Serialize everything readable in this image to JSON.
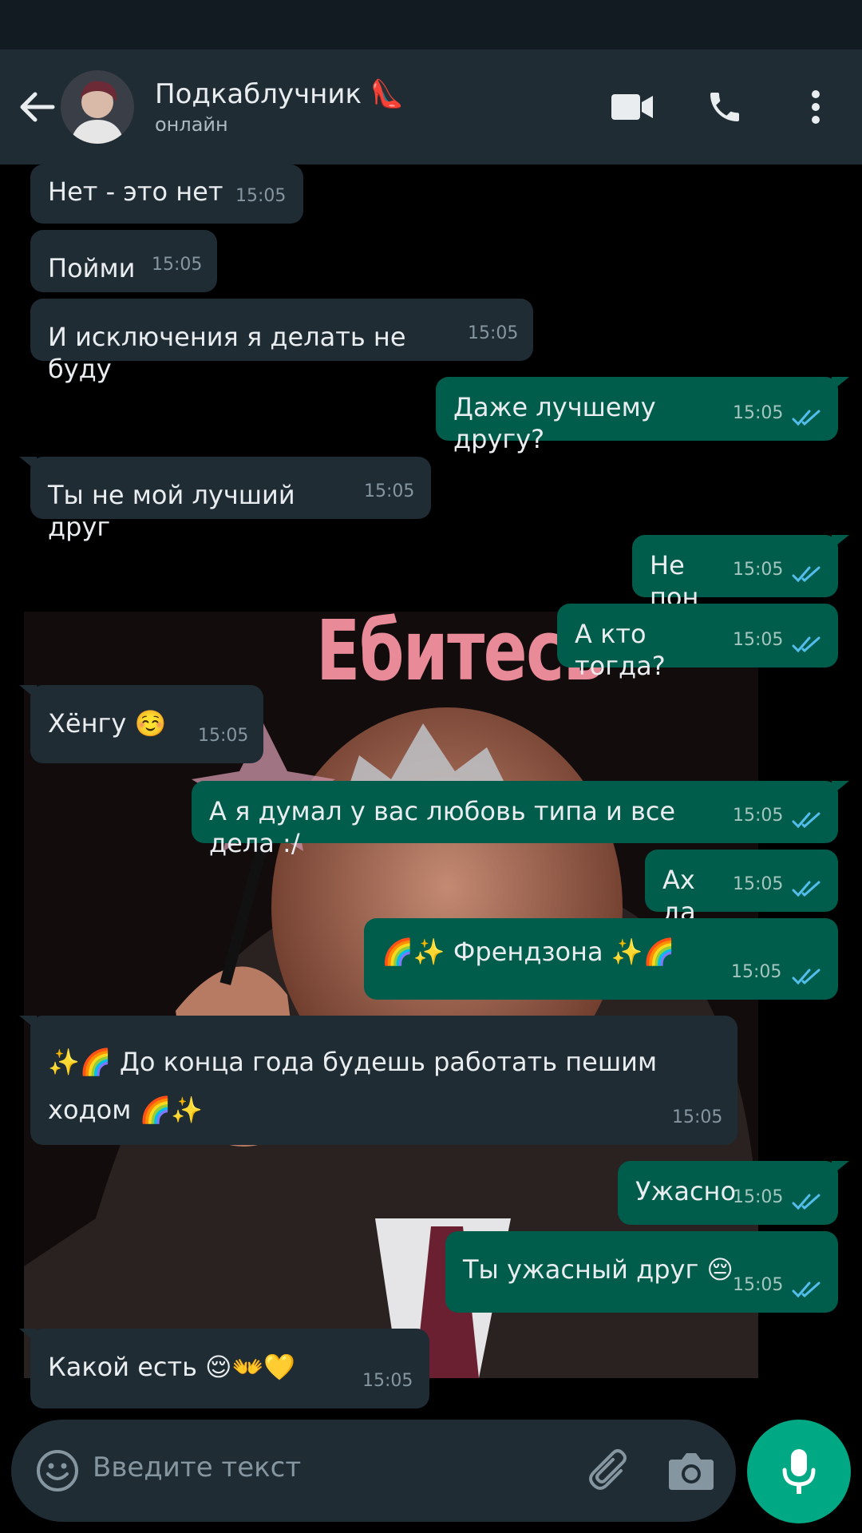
{
  "header": {
    "name": "Подкаблучник",
    "name_emoji": "👠",
    "status": "онлайн"
  },
  "sticker": {
    "caption": "Ебитесь"
  },
  "messages": [
    {
      "dir": "in",
      "text": "Нет - это нет",
      "time": "15:05"
    },
    {
      "dir": "in",
      "text": "Пойми",
      "time": "15:05"
    },
    {
      "dir": "in",
      "text": "И исключения я делать не буду",
      "time": "15:05"
    },
    {
      "dir": "out",
      "text": "Даже лучшему другу?",
      "time": "15:05"
    },
    {
      "dir": "in",
      "text": "Ты не мой лучший друг",
      "time": "15:05"
    },
    {
      "dir": "out",
      "text": "Не пон",
      "time": "15:05"
    },
    {
      "dir": "out",
      "text": "А кто тогда?",
      "time": "15:05"
    },
    {
      "dir": "in",
      "text": "Хёнгу ☺️",
      "time": "15:05"
    },
    {
      "dir": "out",
      "text": "А я думал у вас любовь типа и все дела :/",
      "time": "15:05"
    },
    {
      "dir": "out",
      "text": "Ах да",
      "time": "15:05"
    },
    {
      "dir": "out",
      "text": "🌈✨ Френдзона ✨🌈",
      "time": "15:05"
    },
    {
      "dir": "in",
      "text": "✨🌈 До конца года будешь работать пешим ходом 🌈✨",
      "time": "15:05"
    },
    {
      "dir": "out",
      "text": "Ужасно",
      "time": "15:05"
    },
    {
      "dir": "out",
      "text": "Ты ужасный друг 😔",
      "time": "15:05"
    },
    {
      "dir": "in",
      "text": "Какой есть 😌👐💛",
      "time": "15:05"
    }
  ],
  "composer": {
    "placeholder": "Введите текст"
  },
  "colors": {
    "header_bg": "#1f2c34",
    "incoming_bubble": "#1f2c34",
    "outgoing_bubble": "#005c4b",
    "read_ticks": "#53bdeb",
    "mic_button": "#00a884"
  },
  "icons": [
    "back-arrow-icon",
    "video-call-icon",
    "phone-icon",
    "more-vert-icon",
    "emoji-icon",
    "attach-icon",
    "camera-icon",
    "mic-icon",
    "double-check-icon"
  ]
}
